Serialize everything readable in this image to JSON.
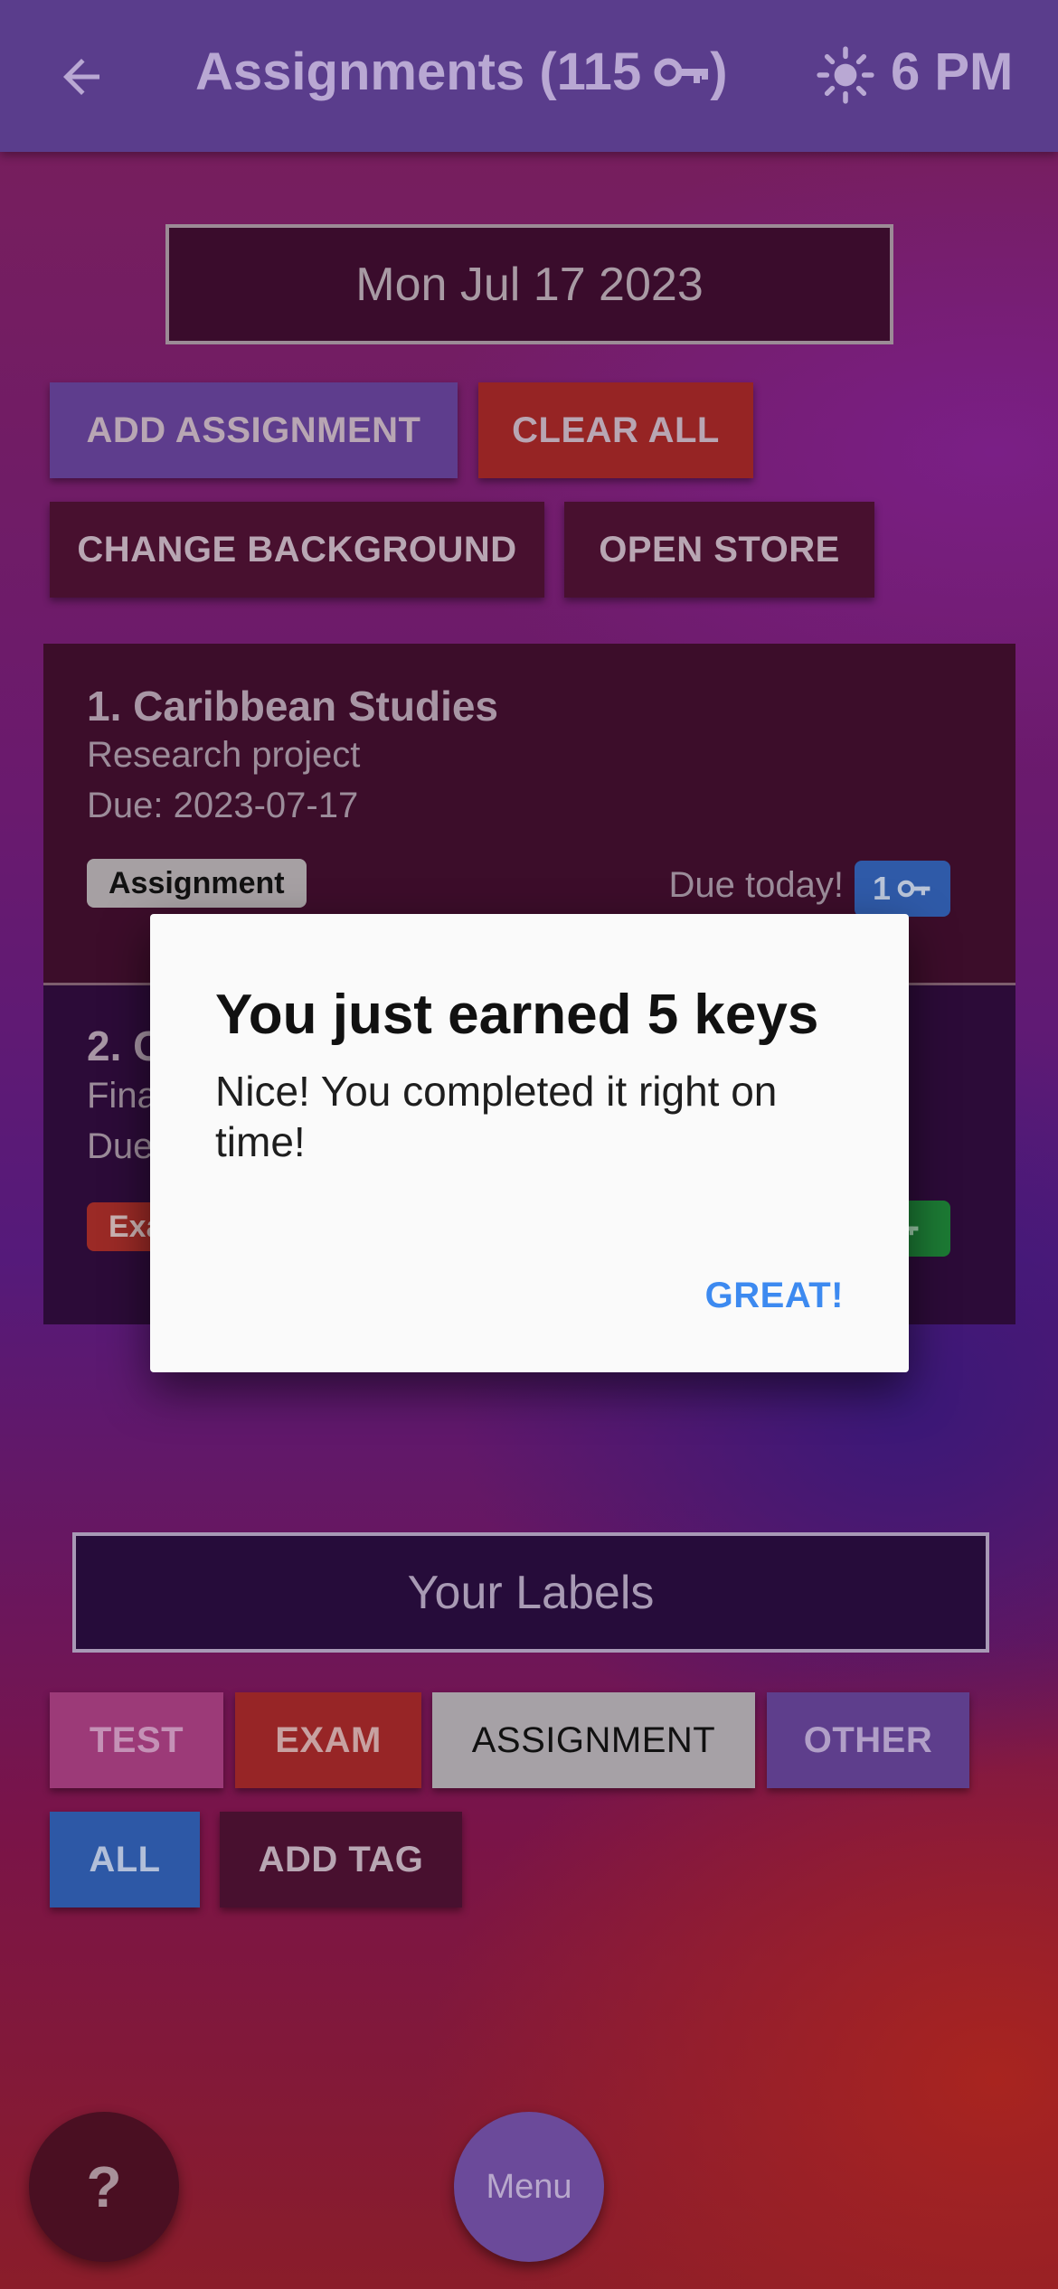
{
  "app_bar": {
    "title": "Assignments (115",
    "title_suffix": ")",
    "time": "6 PM",
    "icons": [
      "back-arrow-icon",
      "key-icon",
      "sun-icon"
    ]
  },
  "date": "Mon Jul 17 2023",
  "actions": {
    "add_assignment": "ADD ASSIGNMENT",
    "clear_all": "CLEAR ALL",
    "change_background": "CHANGE BACKGROUND",
    "open_store": "OPEN STORE"
  },
  "assignments": [
    {
      "title": "1. Caribbean Studies",
      "subtitle": "Research project",
      "due": "Due: 2023-07-17",
      "tag": "Assignment",
      "status": "Due today!",
      "keys": "1"
    },
    {
      "title": "2. C",
      "subtitle": "Fina",
      "due": "Due",
      "tag": "Exa"
    }
  ],
  "dialog": {
    "title": "You just earned 5 keys",
    "body": "Nice! You completed it right on time!",
    "action": "GREAT!"
  },
  "labels": {
    "heading": "Your Labels",
    "tags": [
      "TEST",
      "EXAM",
      "ASSIGNMENT",
      "OTHER",
      "ALL",
      "ADD TAG"
    ]
  },
  "fab": {
    "help": "?",
    "menu": "Menu"
  },
  "colors": {
    "app_bar": "#5a3d8c",
    "dialog_action": "#3d8af0",
    "badge_blue": "#2f5aa8",
    "badge_green": "#1c7a34"
  }
}
